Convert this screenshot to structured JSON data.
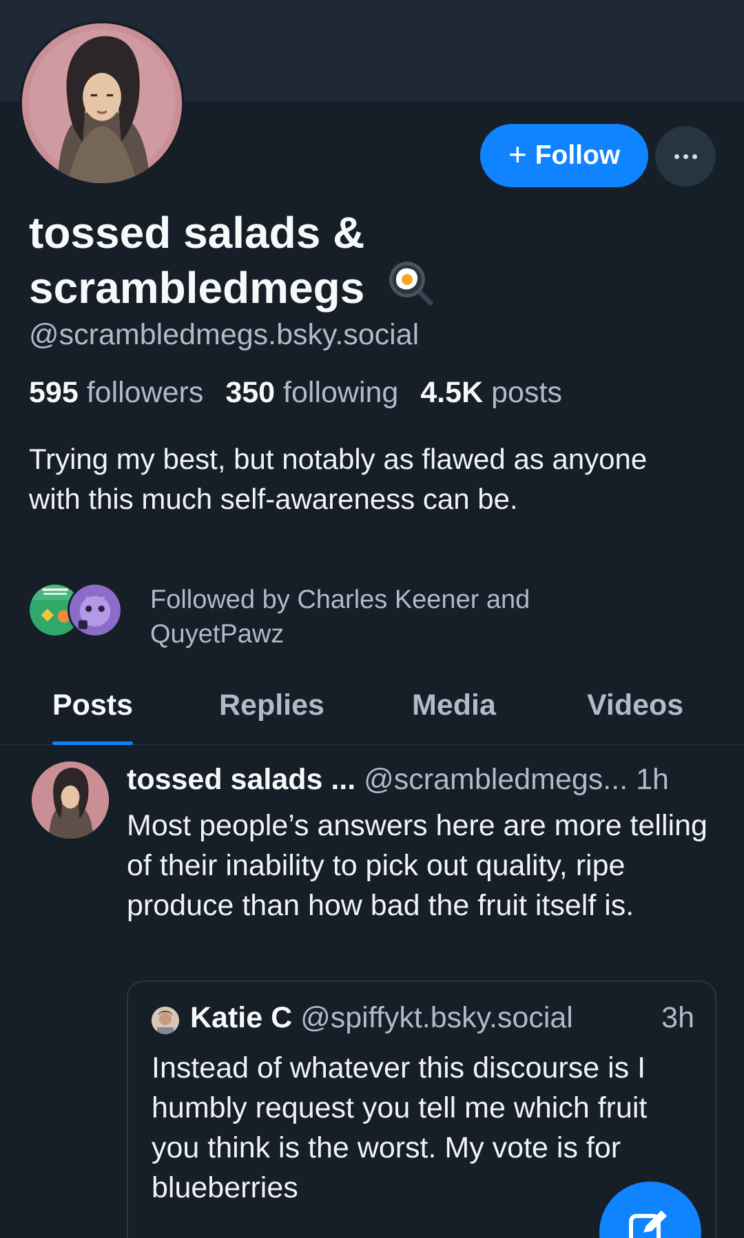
{
  "profile": {
    "display_name": "tossed salads & scrambledmegs",
    "display_emoji": "egg-frying-pan",
    "handle": "@scrambledmegs.bsky.social",
    "stats": {
      "followers_count": "595",
      "followers_label": "followers",
      "following_count": "350",
      "following_label": "following",
      "posts_count": "4.5K",
      "posts_label": "posts"
    },
    "bio": "Trying my best, but notably as flawed as anyone with this much self-awareness can be.",
    "followed_by": "Followed by Charles Keener and QuyetPawz"
  },
  "actions": {
    "follow_label": "Follow",
    "follow_icon": "plus-icon",
    "more_icon": "ellipsis-icon"
  },
  "tabs": [
    {
      "label": "Posts",
      "active": true
    },
    {
      "label": "Replies",
      "active": false
    },
    {
      "label": "Media",
      "active": false
    },
    {
      "label": "Videos",
      "active": false
    }
  ],
  "post": {
    "author_name": "tossed salads ...",
    "author_handle": "@scrambledmegs...",
    "time": "1h",
    "text": "Most people’s answers here are more telling of their inability to pick out quality, ripe produce than how bad the fruit itself is.",
    "quote": {
      "author_name": "Katie C",
      "author_handle": "@spiffykt.bsky.social",
      "time": "3h",
      "text": "Instead of whatever this discourse is I humbly request you tell me which fruit you think is the worst. My vote is for blueberries"
    }
  },
  "fab": {
    "icon": "compose-icon"
  },
  "colors": {
    "background": "#161e27",
    "banner": "#1e2935",
    "accent": "#1083fe",
    "muted_text": "#aebbc9",
    "divider": "#2a3644"
  }
}
